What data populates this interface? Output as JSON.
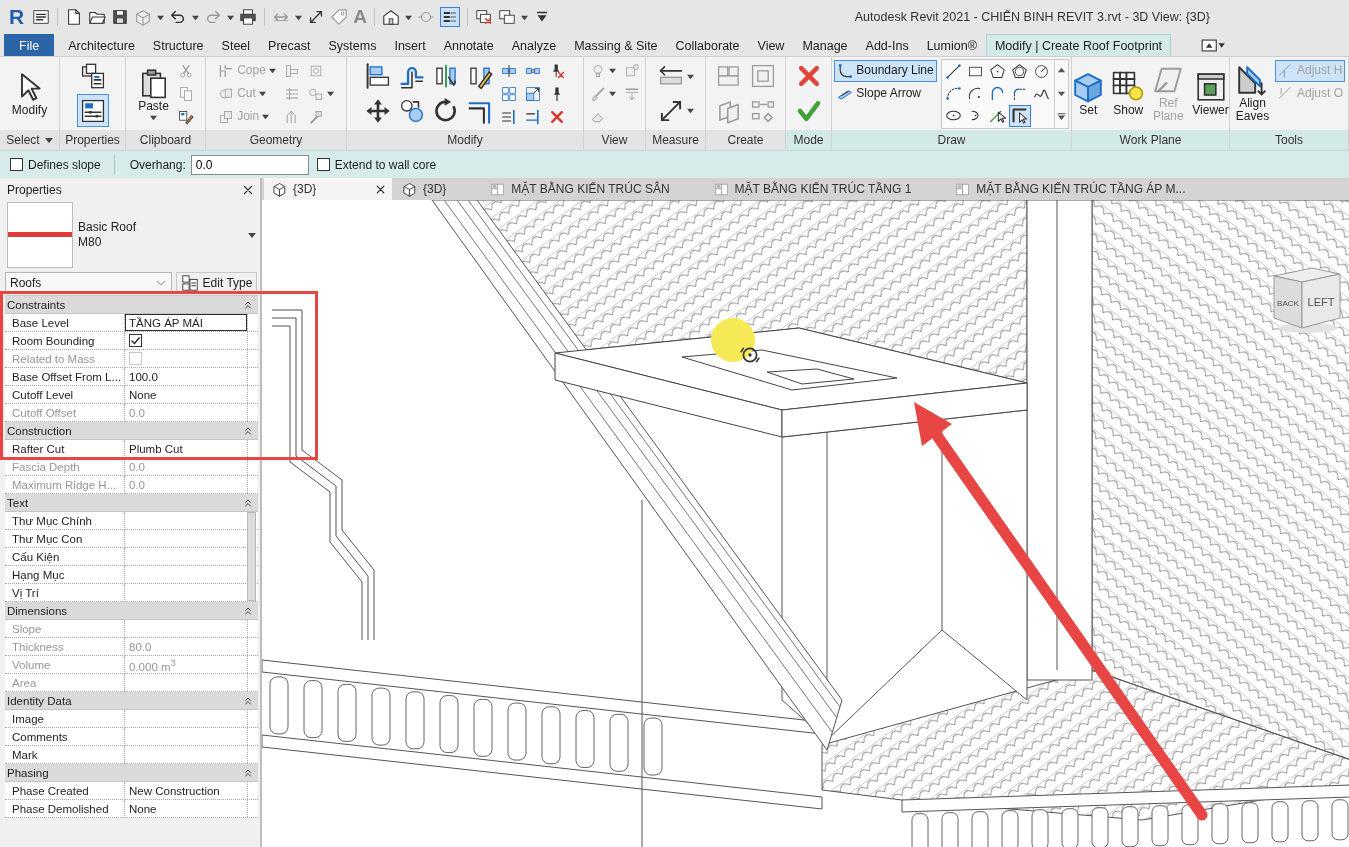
{
  "window": {
    "title": "Autodesk Revit 2021 - CHIẾN BINH REVIT 3.rvt - 3D View: {3D}"
  },
  "quick_access": {
    "logo": "R",
    "text_glyph": "A",
    "thin_lines_on": true
  },
  "ribbon_tabs": [
    {
      "label": "File",
      "kind": "file",
      "selected": false
    },
    {
      "label": "Architecture",
      "kind": "tab",
      "selected": false
    },
    {
      "label": "Structure",
      "kind": "tab",
      "selected": false
    },
    {
      "label": "Steel",
      "kind": "tab",
      "selected": false
    },
    {
      "label": "Precast",
      "kind": "tab",
      "selected": false
    },
    {
      "label": "Systems",
      "kind": "tab",
      "selected": false
    },
    {
      "label": "Insert",
      "kind": "tab",
      "selected": false
    },
    {
      "label": "Annotate",
      "kind": "tab",
      "selected": false
    },
    {
      "label": "Analyze",
      "kind": "tab",
      "selected": false
    },
    {
      "label": "Massing & Site",
      "kind": "tab",
      "selected": false
    },
    {
      "label": "Collaborate",
      "kind": "tab",
      "selected": false
    },
    {
      "label": "View",
      "kind": "tab",
      "selected": false
    },
    {
      "label": "Manage",
      "kind": "tab",
      "selected": false
    },
    {
      "label": "Add-Ins",
      "kind": "tab",
      "selected": false
    },
    {
      "label": "Lumion®",
      "kind": "tab",
      "selected": false
    },
    {
      "label": "Modify | Create Roof Footprint",
      "kind": "tab",
      "selected": true
    }
  ],
  "ribbon": [
    {
      "title": "Select",
      "dropdown": true,
      "context": false,
      "tools": [
        {
          "kind": "large",
          "label": "Modify",
          "disabled": false,
          "selected": false,
          "dropdown": false
        }
      ]
    },
    {
      "title": "Properties",
      "dropdown": false,
      "context": false,
      "tools": [
        {
          "kind": "medium",
          "disabled": false,
          "selected": false,
          "dropdown": false
        },
        {
          "kind": "medium",
          "disabled": false,
          "selected": true,
          "dropdown": false
        }
      ]
    },
    {
      "title": "Clipboard",
      "dropdown": false,
      "context": false,
      "tools": [
        {
          "kind": "large",
          "label": "Paste",
          "disabled": false,
          "selected": false,
          "dropdown": true
        },
        {
          "kind": "icon",
          "disabled": true,
          "selected": false,
          "dropdown": false
        },
        {
          "kind": "icon",
          "disabled": true,
          "selected": false,
          "dropdown": false
        },
        {
          "kind": "icon",
          "disabled": false,
          "selected": false,
          "dropdown": false
        }
      ]
    },
    {
      "title": "Geometry",
      "dropdown": false,
      "context": false,
      "tools": [
        {
          "kind": "small",
          "label": "Cope",
          "disabled": true,
          "selected": false,
          "dropdown": true
        },
        {
          "kind": "small",
          "label": "Cut",
          "disabled": true,
          "selected": false,
          "dropdown": true
        },
        {
          "kind": "small",
          "label": "Join",
          "disabled": true,
          "selected": false,
          "dropdown": true
        },
        {
          "kind": "icon",
          "disabled": true,
          "selected": false,
          "dropdown": false
        },
        {
          "kind": "icon",
          "disabled": true,
          "selected": false,
          "dropdown": false
        },
        {
          "kind": "icon",
          "disabled": true,
          "selected": false,
          "dropdown": false
        },
        {
          "kind": "icon",
          "disabled": true,
          "selected": false,
          "dropdown": false
        },
        {
          "kind": "icon",
          "disabled": true,
          "selected": false,
          "dropdown": true
        },
        {
          "kind": "icon",
          "disabled": true,
          "selected": false,
          "dropdown": false
        }
      ]
    },
    {
      "title": "Modify",
      "dropdown": false,
      "context": false,
      "tools": [
        {
          "kind": "medium",
          "disabled": false,
          "selected": false,
          "dropdown": false
        },
        {
          "kind": "medium",
          "disabled": false,
          "selected": false,
          "dropdown": false
        },
        {
          "kind": "medium",
          "disabled": false,
          "selected": false,
          "dropdown": false
        },
        {
          "kind": "medium",
          "disabled": false,
          "selected": false,
          "dropdown": false
        },
        {
          "kind": "medium",
          "disabled": false,
          "selected": false,
          "dropdown": false
        },
        {
          "kind": "medium",
          "disabled": false,
          "selected": false,
          "dropdown": false
        },
        {
          "kind": "medium",
          "disabled": false,
          "selected": false,
          "dropdown": false
        },
        {
          "kind": "medium",
          "disabled": false,
          "selected": false,
          "dropdown": false
        },
        {
          "kind": "icon",
          "disabled": false,
          "selected": false,
          "dropdown": false
        },
        {
          "kind": "icon",
          "disabled": false,
          "selected": false,
          "dropdown": false
        },
        {
          "kind": "icon",
          "disabled": false,
          "selected": false,
          "dropdown": false
        },
        {
          "kind": "icon",
          "disabled": false,
          "selected": false,
          "dropdown": false
        },
        {
          "kind": "icon",
          "disabled": false,
          "selected": false,
          "dropdown": false
        },
        {
          "kind": "icon",
          "disabled": false,
          "selected": false,
          "dropdown": false
        },
        {
          "kind": "icon",
          "disabled": false,
          "selected": false,
          "dropdown": false
        },
        {
          "kind": "icon",
          "disabled": false,
          "selected": false,
          "dropdown": false
        },
        {
          "kind": "icon",
          "disabled": false,
          "selected": false,
          "dropdown": false
        }
      ]
    },
    {
      "title": "View",
      "dropdown": false,
      "context": false,
      "tools": [
        {
          "kind": "icon",
          "disabled": true,
          "selected": false,
          "dropdown": true
        },
        {
          "kind": "icon",
          "disabled": true,
          "selected": false,
          "dropdown": true
        },
        {
          "kind": "icon",
          "disabled": true,
          "selected": false,
          "dropdown": false
        },
        {
          "kind": "icon",
          "disabled": true,
          "selected": false,
          "dropdown": false
        },
        {
          "kind": "icon",
          "disabled": true,
          "selected": false,
          "dropdown": false
        }
      ]
    },
    {
      "title": "Measure",
      "dropdown": false,
      "context": false,
      "tools": [
        {
          "kind": "medium",
          "disabled": false,
          "selected": false,
          "dropdown": true
        },
        {
          "kind": "medium",
          "disabled": false,
          "selected": false,
          "dropdown": true
        }
      ]
    },
    {
      "title": "Create",
      "dropdown": false,
      "context": false,
      "tools": [
        {
          "kind": "medium",
          "disabled": true,
          "selected": false,
          "dropdown": false
        },
        {
          "kind": "medium",
          "disabled": true,
          "selected": false,
          "dropdown": false
        },
        {
          "kind": "medium",
          "disabled": true,
          "selected": false,
          "dropdown": false
        },
        {
          "kind": "medium",
          "disabled": true,
          "selected": false,
          "dropdown": false
        }
      ]
    },
    {
      "title": "Mode",
      "dropdown": false,
      "context": true,
      "tools": [
        {
          "kind": "medium",
          "disabled": false,
          "selected": false,
          "dropdown": false
        },
        {
          "kind": "medium",
          "disabled": false,
          "selected": false,
          "dropdown": false
        }
      ]
    },
    {
      "title": "Draw",
      "dropdown": false,
      "context": true,
      "tools": [
        {
          "kind": "small",
          "label": "Boundary Line",
          "disabled": false,
          "selected": true,
          "dropdown": false
        },
        {
          "kind": "small",
          "label": "Slope Arrow",
          "disabled": false,
          "selected": false,
          "dropdown": false
        }
      ],
      "gallery": [
        {
          "selected": false
        },
        {
          "selected": false
        },
        {
          "selected": false
        },
        {
          "selected": false
        },
        {
          "selected": false
        },
        {
          "selected": false
        },
        {
          "selected": false
        },
        {
          "selected": false
        },
        {
          "selected": false
        },
        {
          "selected": false
        },
        {
          "selected": false
        },
        {
          "selected": false
        },
        {
          "selected": false
        },
        {
          "selected": true
        }
      ]
    },
    {
      "title": "Work Plane",
      "dropdown": false,
      "context": true,
      "tools": [
        {
          "kind": "large",
          "label": "Set",
          "disabled": false,
          "selected": false,
          "dropdown": false
        },
        {
          "kind": "large",
          "label": "Show",
          "disabled": false,
          "selected": false,
          "dropdown": false
        },
        {
          "kind": "large",
          "label": "Ref Plane",
          "disabled": true,
          "selected": false,
          "dropdown": false
        },
        {
          "kind": "large",
          "label": "Viewer",
          "disabled": false,
          "selected": false,
          "dropdown": false
        }
      ]
    },
    {
      "title": "Tools",
      "dropdown": false,
      "context": true,
      "tools": [
        {
          "kind": "large",
          "label": "Align Eaves",
          "disabled": false,
          "selected": false,
          "dropdown": false
        },
        {
          "kind": "small",
          "label": "Adjust H",
          "disabled": true,
          "selected": true,
          "dropdown": false
        },
        {
          "kind": "small",
          "label": "Adjust O",
          "disabled": true,
          "selected": false,
          "dropdown": false
        }
      ]
    }
  ],
  "options_bar": {
    "defines_slope": {
      "label": "Defines slope",
      "checked": false
    },
    "overhang": {
      "label": "Overhang:",
      "value": "0.0"
    },
    "extend_to_wall_core": {
      "label": "Extend to wall core",
      "checked": false
    }
  },
  "properties": {
    "title": "Properties",
    "type_family": "Basic Roof",
    "type_name": "M80",
    "category": "Roofs",
    "edit_type": "Edit Type",
    "groups": [
      {
        "name": "Constraints",
        "expanded": true,
        "rows": [
          {
            "name": "Base Level",
            "kind": "text",
            "value": "TẦNG ÁP MÁI",
            "disabled": false,
            "editing": true
          },
          {
            "name": "Room Bounding",
            "kind": "checkbox",
            "checked": true,
            "disabled": false
          },
          {
            "name": "Related to Mass",
            "kind": "checkbox",
            "checked": false,
            "disabled": true
          },
          {
            "name": "Base Offset From L...",
            "kind": "text",
            "value": "100.0",
            "disabled": false,
            "editing": false
          },
          {
            "name": "Cutoff Level",
            "kind": "text",
            "value": "None",
            "disabled": false,
            "editing": false
          },
          {
            "name": "Cutoff Offset",
            "kind": "text",
            "value": "0.0",
            "disabled": true,
            "editing": false
          }
        ]
      },
      {
        "name": "Construction",
        "expanded": true,
        "rows": [
          {
            "name": "Rafter Cut",
            "kind": "text",
            "value": "Plumb Cut",
            "disabled": false,
            "editing": false
          },
          {
            "name": "Fascia Depth",
            "kind": "text",
            "value": "0.0",
            "disabled": true,
            "editing": false
          },
          {
            "name": "Maximum Ridge H...",
            "kind": "text",
            "value": "0.0",
            "disabled": true,
            "editing": false
          }
        ]
      },
      {
        "name": "Text",
        "expanded": true,
        "rows": [
          {
            "name": "Thư Mục Chính",
            "kind": "text",
            "disabled": false,
            "editing": false
          },
          {
            "name": "Thư Mục Con",
            "kind": "text",
            "disabled": false,
            "editing": false
          },
          {
            "name": "Cấu Kiện",
            "kind": "text",
            "disabled": false,
            "editing": false
          },
          {
            "name": "Hạng Mục",
            "kind": "text",
            "disabled": false,
            "editing": false
          },
          {
            "name": "Vị Trí",
            "kind": "text",
            "disabled": false,
            "editing": false
          }
        ]
      },
      {
        "name": "Dimensions",
        "expanded": true,
        "rows": [
          {
            "name": "Slope",
            "kind": "text",
            "disabled": true,
            "editing": false
          },
          {
            "name": "Thickness",
            "kind": "text",
            "value": "80.0",
            "disabled": true,
            "editing": false
          },
          {
            "name": "Volume",
            "kind": "text",
            "value": "0.000 m$^{3}$",
            "disabled": true,
            "editing": false
          },
          {
            "name": "Area",
            "kind": "text",
            "disabled": true,
            "editing": false
          }
        ]
      },
      {
        "name": "Identity Data",
        "expanded": true,
        "rows": [
          {
            "name": "Image",
            "kind": "text",
            "disabled": false,
            "editing": false
          },
          {
            "name": "Comments",
            "kind": "text",
            "disabled": false,
            "editing": false
          },
          {
            "name": "Mark",
            "kind": "text",
            "disabled": false,
            "editing": false
          }
        ]
      },
      {
        "name": "Phasing",
        "expanded": true,
        "rows": [
          {
            "name": "Phase Created",
            "kind": "text",
            "value": "New Construction",
            "disabled": false,
            "editing": false
          },
          {
            "name": "Phase Demolished",
            "kind": "text",
            "value": "None",
            "disabled": false,
            "editing": false
          }
        ]
      }
    ]
  },
  "view_tabs": [
    {
      "label": "{3D}",
      "kind": "model",
      "selected": true
    },
    {
      "label": "{3D}",
      "kind": "model",
      "selected": false
    },
    {
      "label": "MẶT BẰNG KIẾN TRÚC SÂN",
      "kind": "plan",
      "selected": false
    },
    {
      "label": "MẶT BẰNG KIẾN TRÚC TẦNG 1",
      "kind": "plan",
      "selected": false
    },
    {
      "label": "MẶT BẰNG KIẾN TRÚC TẦNG ÁP M...",
      "kind": "plan",
      "selected": false
    }
  ],
  "viewport": {
    "view_cube": [
      "BACK",
      "LEFT"
    ]
  }
}
